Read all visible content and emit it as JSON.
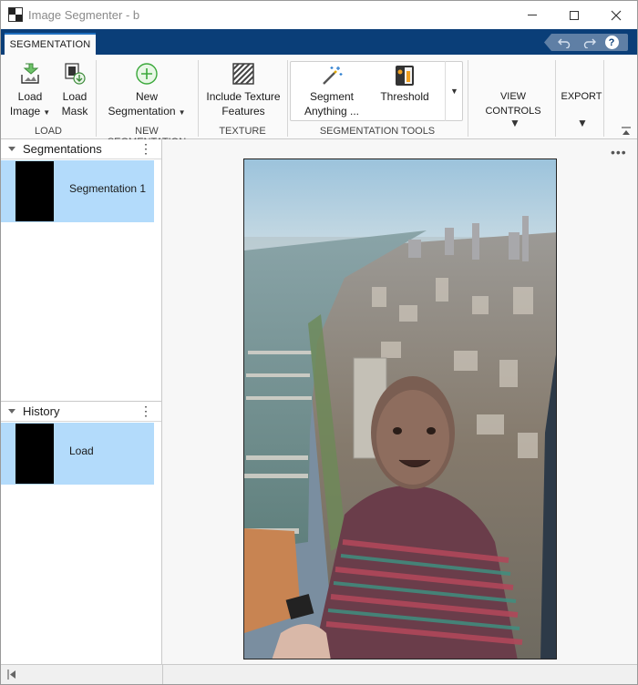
{
  "window": {
    "title": "Image Segmenter - b"
  },
  "tabs": [
    {
      "label": "SEGMENTATION",
      "active": true
    }
  ],
  "ribbon": {
    "load_group": {
      "label": "LOAD",
      "load_image_line1": "Load",
      "load_image_line2": "Image",
      "load_mask_line1": "Load",
      "load_mask_line2": "Mask"
    },
    "new_segmentation_group": {
      "label": "NEW SEGMENTATION",
      "button_line1": "New",
      "button_line2": "Segmentation"
    },
    "texture_group": {
      "label": "TEXTURE",
      "button_line1": "Include Texture",
      "button_line2": "Features"
    },
    "tools_group": {
      "label": "SEGMENTATION TOOLS",
      "segment_anything_line1": "Segment",
      "segment_anything_line2": "Anything ...",
      "threshold": "Threshold"
    },
    "view_controls": "VIEW CONTROLS",
    "export": "EXPORT"
  },
  "segmentations_panel": {
    "title": "Segmentations",
    "items": [
      {
        "label": "Segmentation 1",
        "selected": true
      }
    ]
  },
  "history_panel": {
    "title": "History",
    "items": [
      {
        "label": "Load",
        "selected": true
      }
    ]
  },
  "colors": {
    "tab_strip": "#0a3e78",
    "selection": "#b3dbfb",
    "accent": "#1f6fbf"
  },
  "icons": {
    "app": "image-segmenter-icon",
    "undo": "undo-icon",
    "redo": "redo-icon",
    "help": "help-icon"
  }
}
